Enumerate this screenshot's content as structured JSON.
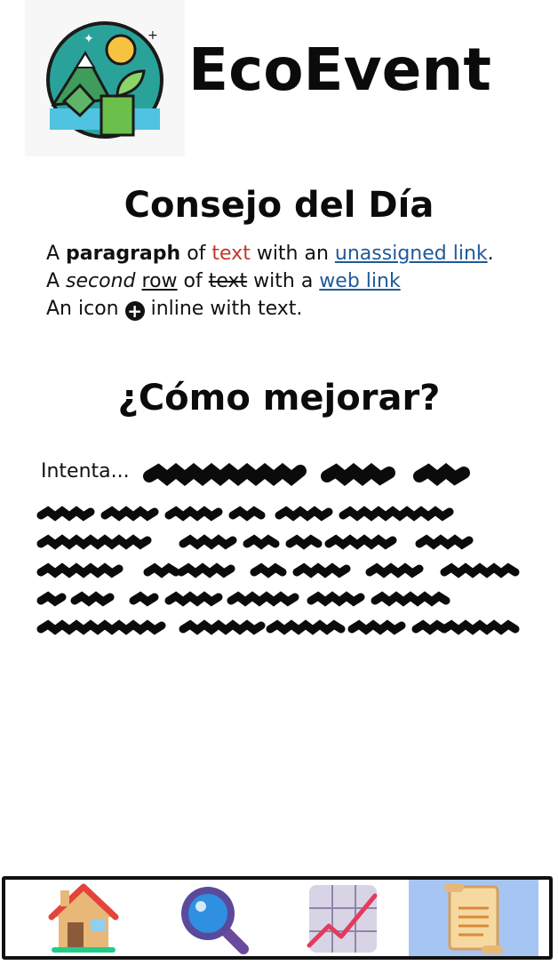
{
  "app": {
    "title": "EcoEvent",
    "logo_icon": "eco-leaf-mountain-logo-icon"
  },
  "tip_section": {
    "title": "Consejo del Día",
    "line1": {
      "a": "A ",
      "b": "paragraph",
      "c": " of ",
      "d": "text",
      "e": " with an ",
      "link": "unassigned link",
      "f": "."
    },
    "line2": {
      "a": "A ",
      "b": "second",
      "c": " ",
      "d": "row",
      "e": " of ",
      "f": "text",
      "g": " with a ",
      "link": "web link"
    },
    "line3": {
      "a": "An icon ",
      "icon": "+",
      "b": " inline with text."
    }
  },
  "improve_section": {
    "title": "¿Cómo mejorar?",
    "intro": "Intenta..."
  },
  "nav": {
    "items": [
      {
        "name": "home",
        "icon": "home-icon"
      },
      {
        "name": "search",
        "icon": "magnifier-icon"
      },
      {
        "name": "stats",
        "icon": "chart-icon"
      },
      {
        "name": "notes",
        "icon": "scroll-icon",
        "active": true
      }
    ]
  },
  "colors": {
    "link": "#1f5a9a",
    "accent_red": "#c0392b",
    "nav_active": "#a7c5f2"
  }
}
